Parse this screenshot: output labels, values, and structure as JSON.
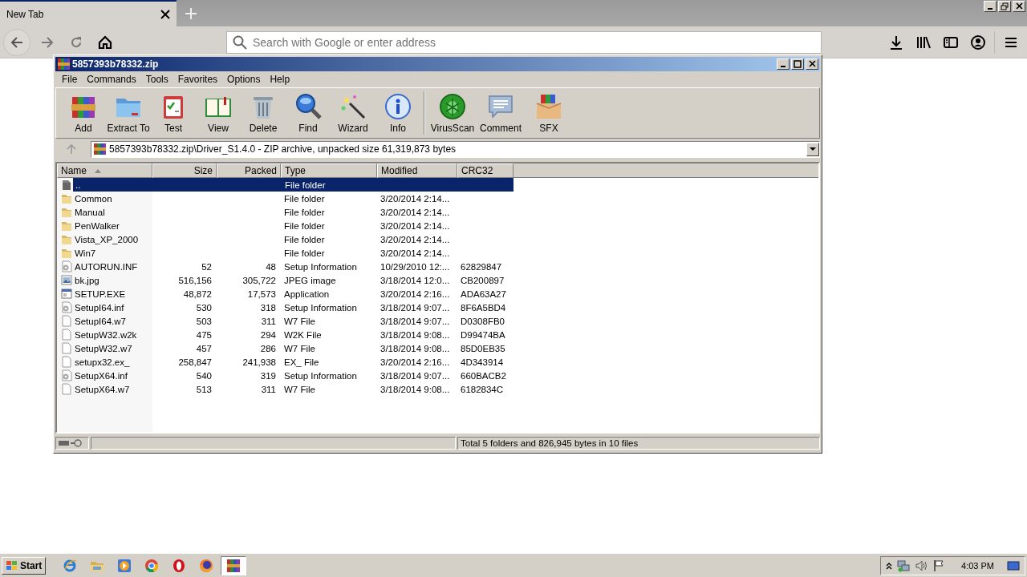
{
  "browser": {
    "tab": {
      "title": "New Tab",
      "selected": true
    },
    "address": {
      "placeholder": "Search with Google or enter address"
    }
  },
  "window": {
    "title": "5857393b78332.zip",
    "menu": [
      "File",
      "Commands",
      "Tools",
      "Favorites",
      "Options",
      "Help"
    ],
    "toolbar_groups": [
      {
        "buttons": [
          {
            "label": "Add",
            "kind": "add"
          },
          {
            "label": "Extract To",
            "kind": "extract"
          },
          {
            "label": "Test",
            "kind": "test"
          },
          {
            "label": "View",
            "kind": "view"
          },
          {
            "label": "Delete",
            "kind": "delete"
          },
          {
            "label": "Find",
            "kind": "find"
          },
          {
            "label": "Wizard",
            "kind": "wizard"
          },
          {
            "label": "Info",
            "kind": "info"
          }
        ]
      },
      {
        "buttons": [
          {
            "label": "VirusScan",
            "kind": "virus"
          },
          {
            "label": "Comment",
            "kind": "comment"
          },
          {
            "label": "SFX",
            "kind": "sfx"
          }
        ]
      }
    ],
    "path": "5857393b78332.zip\\Driver_S1.4.0 - ZIP archive, unpacked size 61,319,873 bytes",
    "table": {
      "columns": [
        {
          "label": "Name",
          "sorted": true
        },
        {
          "label": "Size",
          "sorted": false
        },
        {
          "label": "Packed",
          "sorted": false
        },
        {
          "label": "Type",
          "sorted": false
        },
        {
          "label": "Modified",
          "sorted": false
        },
        {
          "label": "CRC32",
          "sorted": false
        }
      ],
      "rows": [
        {
          "kind": "up",
          "name": "..",
          "type": "File folder",
          "selected": true
        },
        {
          "kind": "folder",
          "name": "Common",
          "type": "File folder",
          "modified": "3/20/2014 2:14...",
          "selected": false
        },
        {
          "kind": "folder",
          "name": "Manual",
          "type": "File folder",
          "modified": "3/20/2014 2:14...",
          "selected": false
        },
        {
          "kind": "folder",
          "name": "PenWalker",
          "type": "File folder",
          "modified": "3/20/2014 2:14...",
          "selected": false
        },
        {
          "kind": "folder",
          "name": "Vista_XP_2000",
          "type": "File folder",
          "modified": "3/20/2014 2:14...",
          "selected": false
        },
        {
          "kind": "folder",
          "name": "Win7",
          "type": "File folder",
          "modified": "3/20/2014 2:14...",
          "selected": false
        },
        {
          "kind": "settings",
          "name": "AUTORUN.INF",
          "size": "52",
          "packed": "48",
          "type": "Setup Information",
          "modified": "10/29/2010 12:...",
          "crc": "62829847",
          "selected": false
        },
        {
          "kind": "image",
          "name": "bk.jpg",
          "size": "516,156",
          "packed": "305,722",
          "type": "JPEG image",
          "modified": "3/18/2014 12:0...",
          "crc": "CB200897",
          "selected": false
        },
        {
          "kind": "app",
          "name": "SETUP.EXE",
          "size": "48,872",
          "packed": "17,573",
          "type": "Application",
          "modified": "3/20/2014 2:16...",
          "crc": "ADA63A27",
          "selected": false
        },
        {
          "kind": "settings",
          "name": "SetupI64.inf",
          "size": "530",
          "packed": "318",
          "type": "Setup Information",
          "modified": "3/18/2014 9:07...",
          "crc": "8F6A5BD4",
          "selected": false
        },
        {
          "kind": "file",
          "name": "SetupI64.w7",
          "size": "503",
          "packed": "311",
          "type": "W7 File",
          "modified": "3/18/2014 9:07...",
          "crc": "D0308FB0",
          "selected": false
        },
        {
          "kind": "file",
          "name": "SetupW32.w2k",
          "size": "475",
          "packed": "294",
          "type": "W2K File",
          "modified": "3/18/2014 9:08...",
          "crc": "D99474BA",
          "selected": false
        },
        {
          "kind": "file",
          "name": "SetupW32.w7",
          "size": "457",
          "packed": "286",
          "type": "W7 File",
          "modified": "3/18/2014 9:08...",
          "crc": "85D0EB35",
          "selected": false
        },
        {
          "kind": "file",
          "name": "setupx32.ex_",
          "size": "258,847",
          "packed": "241,938",
          "type": "EX_ File",
          "modified": "3/20/2014 2:16...",
          "crc": "4D343914",
          "selected": false
        },
        {
          "kind": "settings",
          "name": "SetupX64.inf",
          "size": "540",
          "packed": "319",
          "type": "Setup Information",
          "modified": "3/18/2014 9:07...",
          "crc": "660BACB2",
          "selected": false
        },
        {
          "kind": "file",
          "name": "SetupX64.w7",
          "size": "513",
          "packed": "311",
          "type": "W7 File",
          "modified": "3/18/2014 9:08...",
          "crc": "6182834C",
          "selected": false
        }
      ]
    },
    "status": "Total 5 folders and 826,945 bytes in 10 files"
  },
  "taskbar": {
    "start": "Start",
    "apps": [
      {
        "kind": "ie",
        "selected": false
      },
      {
        "kind": "explorer",
        "selected": false
      },
      {
        "kind": "media",
        "selected": false
      },
      {
        "kind": "chrome",
        "selected": false
      },
      {
        "kind": "opera",
        "selected": false
      },
      {
        "kind": "firefox",
        "selected": false
      },
      {
        "kind": "winrar",
        "selected": true
      }
    ],
    "clock": "4:03 PM"
  }
}
